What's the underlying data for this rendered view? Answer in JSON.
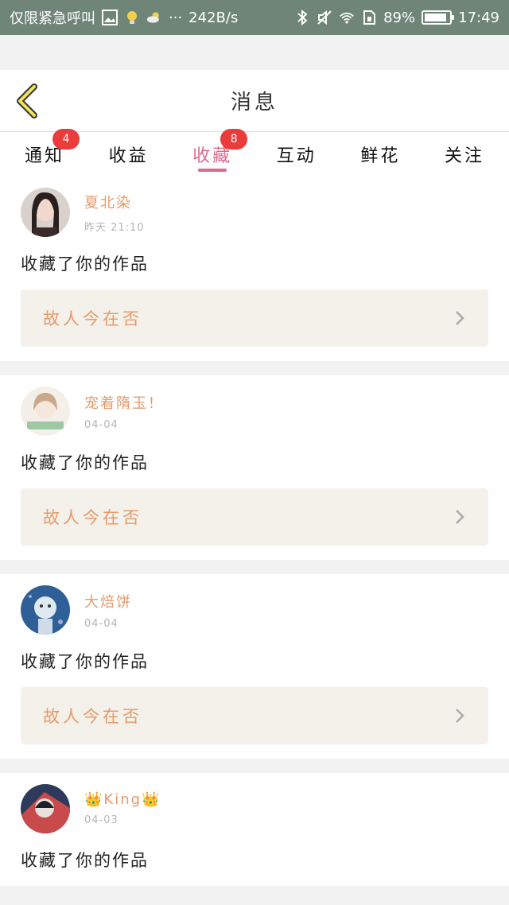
{
  "status_bar": {
    "carrier": "仅限紧急呼叫",
    "net_speed": "242B/s",
    "battery_percent": "89%",
    "battery_level": 0.89,
    "time": "17:49",
    "more": "···"
  },
  "header": {
    "title": "消息"
  },
  "tabs": [
    {
      "label": "通知",
      "badge": "4"
    },
    {
      "label": "收益",
      "badge": ""
    },
    {
      "label": "收藏",
      "badge": "8",
      "active": true
    },
    {
      "label": "互动",
      "badge": ""
    },
    {
      "label": "鲜花",
      "badge": ""
    },
    {
      "label": "关注",
      "badge": ""
    }
  ],
  "feed": [
    {
      "user": "夏北染",
      "time": "昨天 21:10",
      "action": "收藏了你的作品",
      "work": "故人今在否",
      "avatar_color": "#3a2a2a"
    },
    {
      "user": "宠着隋玉！",
      "time": "04-04",
      "action": "收藏了你的作品",
      "work": "故人今在否",
      "avatar_color": "#e8d9c8"
    },
    {
      "user": "大焙饼",
      "time": "04-04",
      "action": "收藏了你的作品",
      "work": "故人今在否",
      "avatar_color": "#5f89b8"
    },
    {
      "user": "👑King👑",
      "time": "04-03",
      "action": "收藏了你的作品",
      "work": "",
      "avatar_color": "#2d3a5c"
    }
  ],
  "colors": {
    "accent": "#d96a8e",
    "name": "#e69a6a",
    "badge": "#ec3b3b",
    "status_bar": "#6e8578"
  }
}
